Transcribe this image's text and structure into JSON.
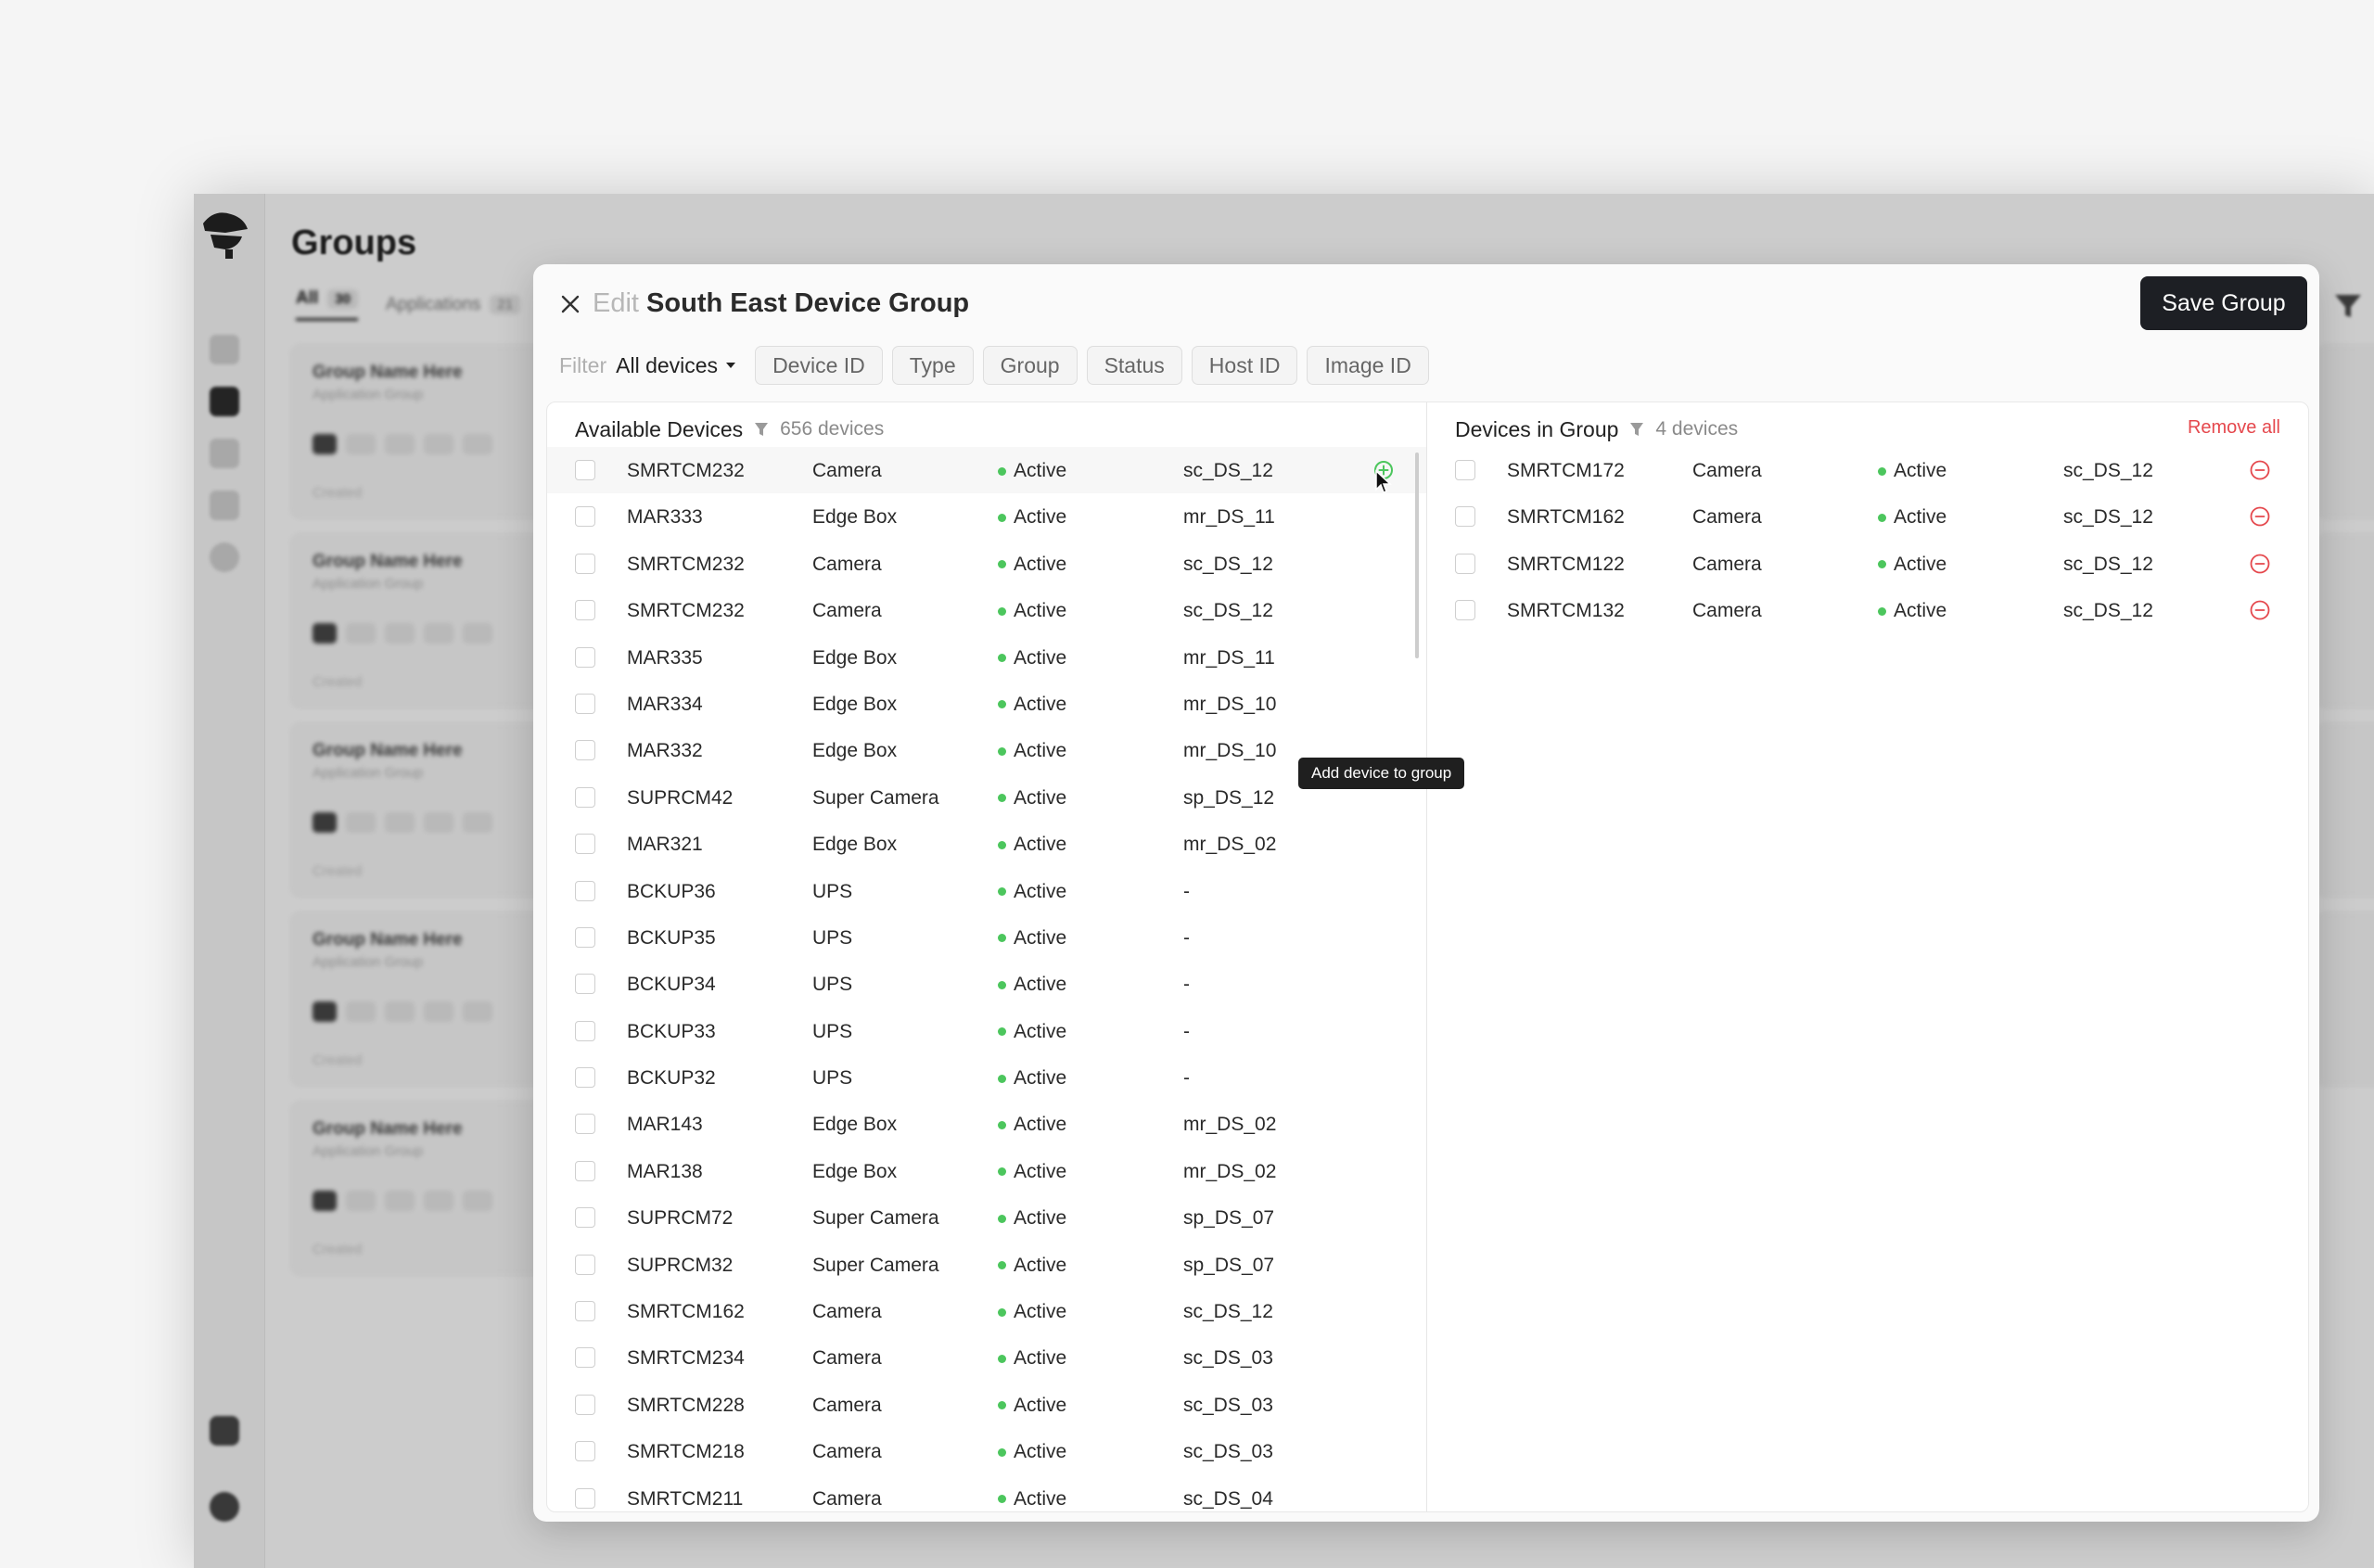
{
  "background": {
    "page_title": "Groups",
    "tabs": [
      {
        "label": "All",
        "count": "30"
      },
      {
        "label": "Applications",
        "count": "21"
      }
    ],
    "cards": [
      {
        "name": "Group Name Here",
        "type": "Application Group",
        "created": "Created"
      },
      {
        "name": "Group Name Here",
        "type": "Application Group",
        "created": "Created"
      },
      {
        "name": "Group Name Here",
        "type": "Application Group",
        "created": "Created"
      },
      {
        "name": "Group Name Here",
        "type": "Application Group",
        "created": "Created"
      },
      {
        "name": "Group Name Here",
        "type": "Application Group",
        "created": "Created"
      }
    ]
  },
  "modal": {
    "title_prefix": "Edit",
    "title": "South East Device Group",
    "save_label": "Save Group",
    "filter": {
      "label": "Filter",
      "selected": "All devices",
      "chips": [
        "Device ID",
        "Type",
        "Group",
        "Status",
        "Host ID",
        "Image ID"
      ]
    },
    "available": {
      "title": "Available Devices",
      "count_label": "656 devices",
      "tooltip": "Add device to group",
      "rows": [
        {
          "id": "SMRTCM232",
          "type": "Camera",
          "status": "Active",
          "host": "sc_DS_12"
        },
        {
          "id": "MAR333",
          "type": "Edge Box",
          "status": "Active",
          "host": "mr_DS_11"
        },
        {
          "id": "SMRTCM232",
          "type": "Camera",
          "status": "Active",
          "host": "sc_DS_12"
        },
        {
          "id": "SMRTCM232",
          "type": "Camera",
          "status": "Active",
          "host": "sc_DS_12"
        },
        {
          "id": "MAR335",
          "type": "Edge Box",
          "status": "Active",
          "host": "mr_DS_11"
        },
        {
          "id": "MAR334",
          "type": "Edge Box",
          "status": "Active",
          "host": "mr_DS_10"
        },
        {
          "id": "MAR332",
          "type": "Edge Box",
          "status": "Active",
          "host": "mr_DS_10"
        },
        {
          "id": "SUPRCM42",
          "type": "Super Camera",
          "status": "Active",
          "host": "sp_DS_12"
        },
        {
          "id": "MAR321",
          "type": "Edge Box",
          "status": "Active",
          "host": "mr_DS_02"
        },
        {
          "id": "BCKUP36",
          "type": "UPS",
          "status": "Active",
          "host": "-"
        },
        {
          "id": "BCKUP35",
          "type": "UPS",
          "status": "Active",
          "host": "-"
        },
        {
          "id": "BCKUP34",
          "type": "UPS",
          "status": "Active",
          "host": "-"
        },
        {
          "id": "BCKUP33",
          "type": "UPS",
          "status": "Active",
          "host": "-"
        },
        {
          "id": "BCKUP32",
          "type": "UPS",
          "status": "Active",
          "host": "-"
        },
        {
          "id": "MAR143",
          "type": "Edge Box",
          "status": "Active",
          "host": "mr_DS_02"
        },
        {
          "id": "MAR138",
          "type": "Edge Box",
          "status": "Active",
          "host": "mr_DS_02"
        },
        {
          "id": "SUPRCM72",
          "type": "Super Camera",
          "status": "Active",
          "host": "sp_DS_07"
        },
        {
          "id": "SUPRCM32",
          "type": "Super Camera",
          "status": "Active",
          "host": "sp_DS_07"
        },
        {
          "id": "SMRTCM162",
          "type": "Camera",
          "status": "Active",
          "host": "sc_DS_12"
        },
        {
          "id": "SMRTCM234",
          "type": "Camera",
          "status": "Active",
          "host": "sc_DS_03"
        },
        {
          "id": "SMRTCM228",
          "type": "Camera",
          "status": "Active",
          "host": "sc_DS_03"
        },
        {
          "id": "SMRTCM218",
          "type": "Camera",
          "status": "Active",
          "host": "sc_DS_03"
        },
        {
          "id": "SMRTCM211",
          "type": "Camera",
          "status": "Active",
          "host": "sc_DS_04"
        }
      ]
    },
    "in_group": {
      "title": "Devices in Group",
      "count_label": "4 devices",
      "remove_all_label": "Remove all",
      "rows": [
        {
          "id": "SMRTCM172",
          "type": "Camera",
          "status": "Active",
          "host": "sc_DS_12"
        },
        {
          "id": "SMRTCM162",
          "type": "Camera",
          "status": "Active",
          "host": "sc_DS_12"
        },
        {
          "id": "SMRTCM122",
          "type": "Camera",
          "status": "Active",
          "host": "sc_DS_12"
        },
        {
          "id": "SMRTCM132",
          "type": "Camera",
          "status": "Active",
          "host": "sc_DS_12"
        }
      ]
    }
  },
  "colors": {
    "status_active": "#4cc65d",
    "remove": "#e5484d",
    "primary_button": "#1d1f24"
  },
  "icons": {
    "close": "close-icon",
    "filter": "filter-icon",
    "add": "add-circle-icon",
    "remove": "remove-circle-icon",
    "dropdown": "caret-down-icon"
  }
}
